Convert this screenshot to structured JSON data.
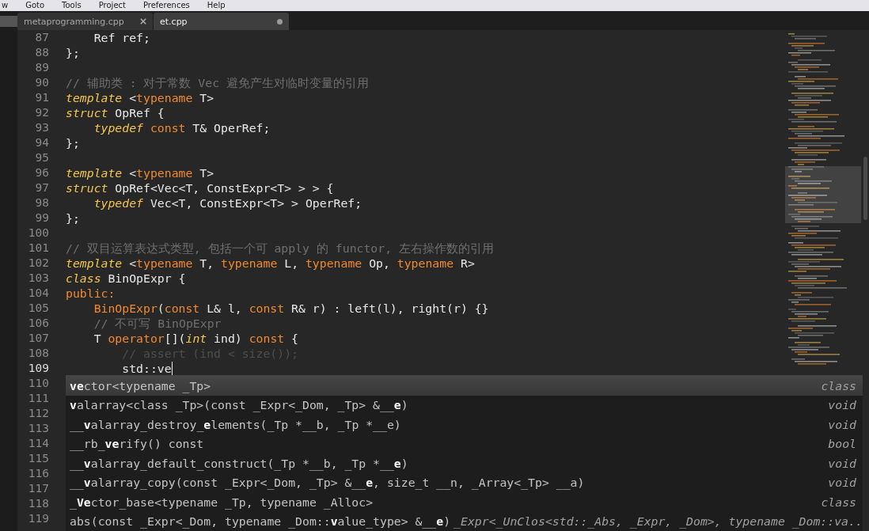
{
  "menu": [
    "w",
    "Goto",
    "Tools",
    "Project",
    "Preferences",
    "Help"
  ],
  "tabs": [
    {
      "label": "metaprogramming.cpp",
      "selected": false,
      "modified": false
    },
    {
      "label": "et.cpp",
      "selected": true,
      "modified": true
    }
  ],
  "code_lines": [
    {
      "number": "87",
      "tokens": [
        {
          "kind": "plain",
          "text": "    Ref ref;"
        }
      ]
    },
    {
      "number": "88",
      "tokens": [
        {
          "kind": "plain",
          "text": "};"
        }
      ]
    },
    {
      "number": "89"
    },
    {
      "number": "90",
      "tokens": [
        {
          "kind": "comment",
          "text": "// 辅助类 : 对于常数 Vec 避免产生对临时变量的引用"
        }
      ]
    },
    {
      "number": "91",
      "tokens": [
        {
          "kind": "keyword",
          "text": "template"
        },
        {
          "kind": "plain",
          "text": " <"
        },
        {
          "kind": "storage",
          "text": "typename"
        },
        {
          "kind": "plain",
          "text": " T>"
        }
      ]
    },
    {
      "number": "92",
      "tokens": [
        {
          "kind": "keyword",
          "text": "struct"
        },
        {
          "kind": "plain",
          "text": " OpRef {"
        }
      ]
    },
    {
      "number": "93",
      "tokens": [
        {
          "kind": "keyword",
          "text": "    typedef "
        },
        {
          "kind": "storage",
          "text": "const"
        },
        {
          "kind": "plain",
          "text": " T& OperRef;"
        }
      ]
    },
    {
      "number": "94",
      "tokens": [
        {
          "kind": "plain",
          "text": "};"
        }
      ]
    },
    {
      "number": "95"
    },
    {
      "number": "96",
      "tokens": [
        {
          "kind": "keyword",
          "text": "template"
        },
        {
          "kind": "plain",
          "text": " <"
        },
        {
          "kind": "storage",
          "text": "typename"
        },
        {
          "kind": "plain",
          "text": " T>"
        }
      ]
    },
    {
      "number": "97",
      "tokens": [
        {
          "kind": "keyword",
          "text": "struct"
        },
        {
          "kind": "plain",
          "text": " OpRef<Vec<T, ConstExpr<T> > > {"
        }
      ]
    },
    {
      "number": "98",
      "tokens": [
        {
          "kind": "keyword",
          "text": "    typedef"
        },
        {
          "kind": "plain",
          "text": " Vec<T, ConstExpr<T> > OperRef;"
        }
      ]
    },
    {
      "number": "99",
      "tokens": [
        {
          "kind": "plain",
          "text": "};"
        }
      ]
    },
    {
      "number": "100"
    },
    {
      "number": "101",
      "tokens": [
        {
          "kind": "comment",
          "text": "// 双目运算表达式类型, 包括一个可 apply 的 functor, 左右操作数的引用"
        }
      ]
    },
    {
      "number": "102",
      "tokens": [
        {
          "kind": "keyword",
          "text": "template"
        },
        {
          "kind": "plain",
          "text": " <"
        },
        {
          "kind": "storage",
          "text": "typename"
        },
        {
          "kind": "plain",
          "text": " T, "
        },
        {
          "kind": "storage",
          "text": "typename"
        },
        {
          "kind": "plain",
          "text": " L, "
        },
        {
          "kind": "storage",
          "text": "typename"
        },
        {
          "kind": "plain",
          "text": " Op, "
        },
        {
          "kind": "storage",
          "text": "typename"
        },
        {
          "kind": "plain",
          "text": " R>"
        }
      ]
    },
    {
      "number": "103",
      "tokens": [
        {
          "kind": "keyword",
          "text": "class"
        },
        {
          "kind": "plain",
          "text": " BinOpExpr {"
        }
      ]
    },
    {
      "number": "104",
      "tokens": [
        {
          "kind": "storage",
          "text": "public:"
        }
      ]
    },
    {
      "number": "105",
      "tokens": [
        {
          "kind": "entity",
          "text": "    BinOpExpr"
        },
        {
          "kind": "plain",
          "text": "("
        },
        {
          "kind": "storage",
          "text": "const"
        },
        {
          "kind": "plain",
          "text": " L& l, "
        },
        {
          "kind": "storage",
          "text": "const"
        },
        {
          "kind": "plain",
          "text": " R& r) : left(l), right(r) {}"
        }
      ]
    },
    {
      "number": "106",
      "tokens": [
        {
          "kind": "comment",
          "text": "    // 不可写 BinOpExpr"
        }
      ]
    },
    {
      "number": "107",
      "tokens": [
        {
          "kind": "plain",
          "text": "    T "
        },
        {
          "kind": "entity",
          "text": "operator"
        },
        {
          "kind": "plain",
          "text": "[]("
        },
        {
          "kind": "keyword",
          "text": "int"
        },
        {
          "kind": "plain",
          "text": " ind) "
        },
        {
          "kind": "storage",
          "text": "const"
        },
        {
          "kind": "plain",
          "text": " {"
        }
      ]
    },
    {
      "number": "108",
      "tokens": [
        {
          "kind": "dim",
          "text": "        // assert (ind < size());"
        }
      ]
    },
    {
      "number": "109",
      "current": true,
      "tokens": [
        {
          "kind": "plain",
          "text": "        std::ve"
        }
      ]
    },
    {
      "number": "110"
    },
    {
      "number": "111"
    },
    {
      "number": "112"
    },
    {
      "number": "113"
    },
    {
      "number": "114"
    },
    {
      "number": "115"
    },
    {
      "number": "116"
    },
    {
      "number": "117"
    },
    {
      "number": "118"
    },
    {
      "number": "119"
    }
  ],
  "completions": [
    {
      "selected": true,
      "parts": [
        {
          "text": "ve",
          "bold": true
        },
        {
          "text": "ctor<typename _Tp>",
          "bold": false
        }
      ],
      "type": "class"
    },
    {
      "selected": false,
      "parts": [
        {
          "text": "v",
          "bold": true
        },
        {
          "text": "alarray<class _Tp>(const _Expr<_Dom, _Tp> &__",
          "bold": false
        },
        {
          "text": "e",
          "bold": true
        },
        {
          "text": ")",
          "bold": false
        }
      ],
      "type": "void"
    },
    {
      "selected": false,
      "parts": [
        {
          "text": "__",
          "bold": false
        },
        {
          "text": "v",
          "bold": true
        },
        {
          "text": "alarray_destroy_",
          "bold": false
        },
        {
          "text": "e",
          "bold": true
        },
        {
          "text": "lements(_Tp *__b, _Tp *__e)",
          "bold": false
        }
      ],
      "type": "void"
    },
    {
      "selected": false,
      "parts": [
        {
          "text": "__rb_",
          "bold": false
        },
        {
          "text": "ve",
          "bold": true
        },
        {
          "text": "rify() const",
          "bold": false
        }
      ],
      "type": "bool"
    },
    {
      "selected": false,
      "parts": [
        {
          "text": "__",
          "bold": false
        },
        {
          "text": "v",
          "bold": true
        },
        {
          "text": "alarray_default_construct(_Tp *__b, _Tp *__",
          "bold": false
        },
        {
          "text": "e",
          "bold": true
        },
        {
          "text": ")",
          "bold": false
        }
      ],
      "type": "void"
    },
    {
      "selected": false,
      "parts": [
        {
          "text": "__",
          "bold": false
        },
        {
          "text": "v",
          "bold": true
        },
        {
          "text": "alarray_copy(const _Expr<_Dom, _Tp> &__",
          "bold": false
        },
        {
          "text": "e",
          "bold": true
        },
        {
          "text": ", size_t __n, _Array<_Tp> __a)",
          "bold": false
        }
      ],
      "type": "void"
    },
    {
      "selected": false,
      "parts": [
        {
          "text": "_",
          "bold": false
        },
        {
          "text": "Ve",
          "bold": true
        },
        {
          "text": "ctor_base<typename _Tp, typename _Alloc>",
          "bold": false
        }
      ],
      "type": "class"
    },
    {
      "selected": false,
      "parts": [
        {
          "text": "abs(const _Expr<_Dom, typename _Dom::",
          "bold": false
        },
        {
          "text": "v",
          "bold": true
        },
        {
          "text": "alue_type> &__",
          "bold": false
        },
        {
          "text": "e",
          "bold": true
        },
        {
          "text": ")",
          "bold": false
        }
      ],
      "type": "_Expr<_UnClos<std::_Abs, _Expr, _Dom>, typename _Dom::va.."
    }
  ]
}
